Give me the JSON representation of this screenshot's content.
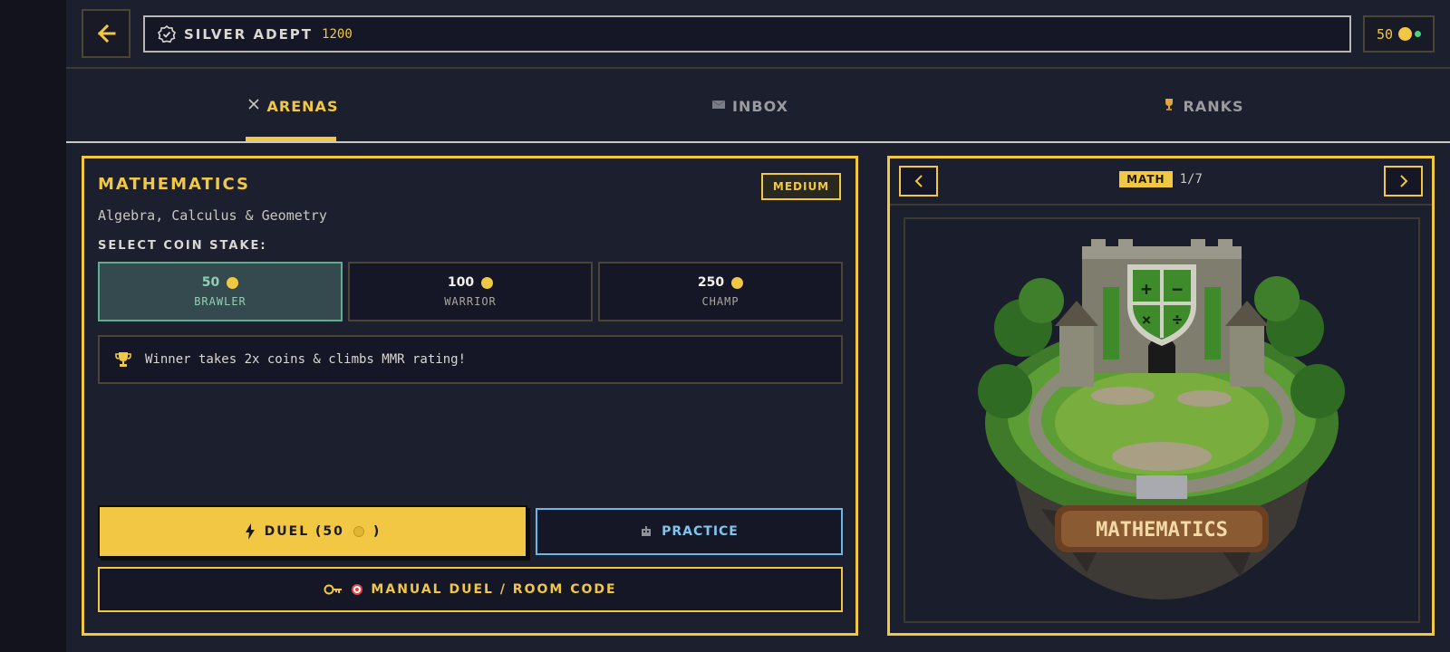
{
  "header": {
    "back_icon": "arrow-left-icon",
    "rank_icon": "verified-badge-icon",
    "rank_name": "SILVER ADEPT",
    "rank_points": "1200",
    "coins": "50",
    "coin_icon": "coin-icon",
    "status_icon": "online-dot-icon"
  },
  "tabs": [
    {
      "label": "ARENAS",
      "icon": "crossed-swords-icon",
      "active": true
    },
    {
      "label": "INBOX",
      "icon": "mail-icon",
      "active": false
    },
    {
      "label": "RANKS",
      "icon": "trophy-icon",
      "active": false
    }
  ],
  "arena": {
    "title": "MATHEMATICS",
    "difficulty": "MEDIUM",
    "subtitle": "Algebra, Calculus & Geometry",
    "stake_label": "SELECT COIN STAKE:",
    "stakes": [
      {
        "amount": "50",
        "tier": "BRAWLER",
        "selected": true
      },
      {
        "amount": "100",
        "tier": "WARRIOR",
        "selected": false
      },
      {
        "amount": "250",
        "tier": "CHAMP",
        "selected": false
      }
    ],
    "info_text": "Winner takes 2x coins & climbs MMR rating!",
    "duel_label": "DUEL (50",
    "duel_suffix": ")",
    "practice_label": "PRACTICE",
    "manual_label": "MANUAL DUEL / ROOM CODE"
  },
  "carousel": {
    "tag": "MATH",
    "index": "1/7",
    "art_banner": "MATHEMATICS"
  },
  "colors": {
    "accent": "#f1c744",
    "selected_stake": "#5fae8f",
    "practice": "#6ab7e8",
    "background": "#1c1f2e"
  }
}
